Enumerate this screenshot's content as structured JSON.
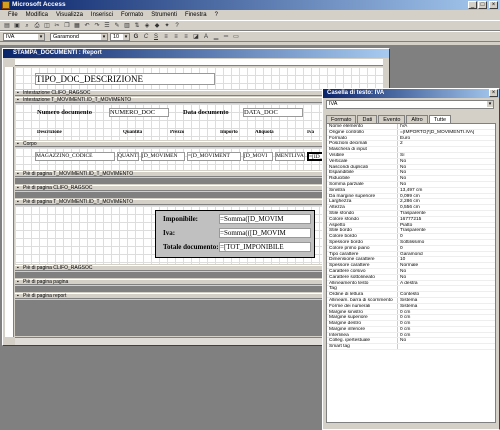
{
  "app": {
    "title": "Microsoft Access"
  },
  "menu": [
    "File",
    "Modifica",
    "Visualizza",
    "Inserisci",
    "Formato",
    "Strumenti",
    "Finestra",
    "?"
  ],
  "toolbar1": {
    "object_combo": "IVA"
  },
  "toolbar2": {
    "font_combo": "Garamond",
    "size_combo": "10"
  },
  "report": {
    "window_title": "STAMPA_DOCUMENTI : Report",
    "title_field": "TIPO_DOC_DESCRIZIONE",
    "bands": {
      "header1": "Intestazione CLIFO_RAGSOC",
      "header2": "Intestazione T_MOVIMENTI.ID_T_MOVIMENTO",
      "corpo": "Corpo",
      "footer1": "Piè di pagina T_MOVIMENTI.ID_T_MOVIMENTO",
      "footer2": "Piè di pagina CLIFO_RAGSOC",
      "footer3": "Piè di pagina T_MOVIMENTI.ID_T_MOVIMENTO",
      "footer4": "Piè di pagina CLIFO_RAGSOC",
      "page_footer": "Piè di pagina pagina",
      "report_footer": "Piè di pagina report"
    },
    "labels": {
      "numero_doc": "Numero documento",
      "data_doc": "Data documento",
      "descrizione": "Descrizione",
      "quantita": "Quantità",
      "prezzo": "Prezzo",
      "importo": "Importo",
      "aliquota": "Aliquota",
      "iva": "Iva"
    },
    "fields": {
      "numero_doc": "NUMERO_DOC",
      "data_doc": "DATA_DOC",
      "magazzino": "MAGAZZINO_CODICE",
      "quanti": "QUANTI",
      "id_mov1": "[D_MOVIMEN",
      "id_mov2": "=[D_MOVIMENT",
      "id_mov3": "[D_MOVI",
      "aliquota": "MENTI.IVA",
      "iva": "=[ID_MOVIM"
    },
    "totals": {
      "imponibile_lbl": "Imponibile:",
      "imponibile_val": "=Somma([D_MOVIM",
      "iva_lbl": "Iva:",
      "iva_val": "=Somma(([D_MOVIM",
      "totale_lbl": "Totale documento:",
      "totale_val": "=[TOT_IMPONIBILE"
    }
  },
  "properties": {
    "window_title": "Casella di testo: IVA",
    "object": "IVA",
    "tabs": [
      "Formato",
      "Dati",
      "Evento",
      "Altro",
      "Tutte"
    ],
    "active_tab": "Tutte",
    "rows": [
      [
        "Nome elemento",
        "IVA"
      ],
      [
        "Origine controllo",
        "=[IMPORTO]*[D_MOVIMENTI.IVA]"
      ],
      [
        "Formato",
        "Euro"
      ],
      [
        "Posizioni decimali",
        "2"
      ],
      [
        "Maschera di input",
        ""
      ],
      [
        "Visibile",
        "Sì"
      ],
      [
        "Verticale",
        "No"
      ],
      [
        "Nascondi duplicati",
        "No"
      ],
      [
        "Espandibile",
        "No"
      ],
      [
        "Riducibile",
        "No"
      ],
      [
        "Somma parziale",
        "No"
      ],
      [
        "Sinistra",
        "13,497 cm"
      ],
      [
        "Da margine superiore",
        "0,099 cm"
      ],
      [
        "Larghezza",
        "2,286 cm"
      ],
      [
        "Altezza",
        "0,556 cm"
      ],
      [
        "Stile sfondo",
        "Trasparente"
      ],
      [
        "Colore sfondo",
        "16777215"
      ],
      [
        "Aspetto",
        "Piatto"
      ],
      [
        "Stile bordo",
        "Trasparente"
      ],
      [
        "Colore bordo",
        "0"
      ],
      [
        "Spessore bordo",
        "Sottilissimo"
      ],
      [
        "Colore primo piano",
        "0"
      ],
      [
        "Tipo carattere",
        "Garamond"
      ],
      [
        "Dimensione carattere",
        "10"
      ],
      [
        "Spessore carattere",
        "Normale"
      ],
      [
        "Carattere corsivo",
        "No"
      ],
      [
        "Carattere sottolineato",
        "No"
      ],
      [
        "Allineamento testo",
        "A destra"
      ],
      [
        "Tag",
        ""
      ],
      [
        "Ordine di lettura",
        "Contesto"
      ],
      [
        "Allineam. barra di scorrimento",
        "Sistema"
      ],
      [
        "Forme dei numerali",
        "Sistema"
      ],
      [
        "Margine sinistro",
        "0 cm"
      ],
      [
        "Margine superiore",
        "0 cm"
      ],
      [
        "Margine destro",
        "0 cm"
      ],
      [
        "Margine inferiore",
        "0 cm"
      ],
      [
        "Interlinea",
        "0 cm"
      ],
      [
        "Colleg. ipertestuale",
        "No"
      ],
      [
        "Smart tag",
        ""
      ]
    ]
  }
}
